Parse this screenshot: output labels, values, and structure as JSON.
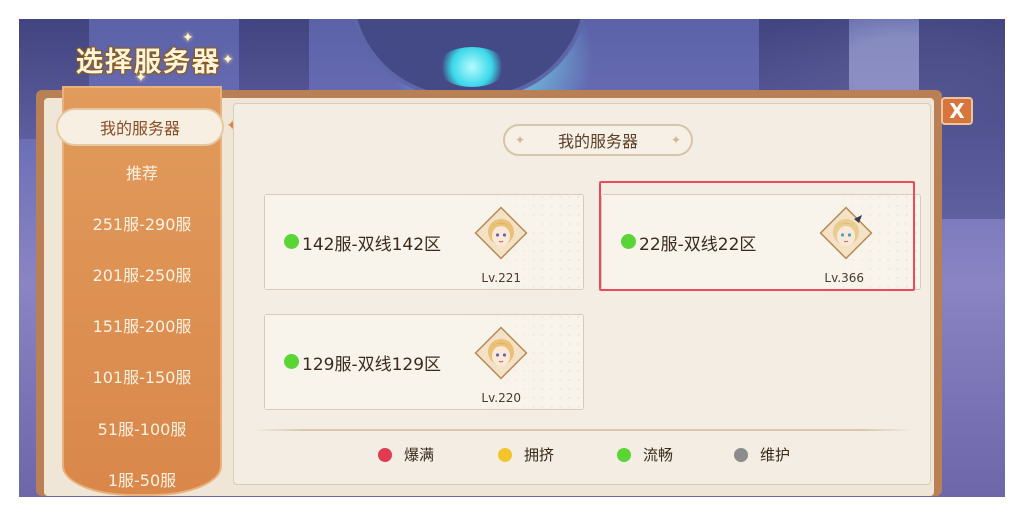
{
  "title": "选择服务器",
  "sidebar": {
    "items": [
      {
        "label": "我的服务器",
        "active": true
      },
      {
        "label": "推荐"
      },
      {
        "label": "251服-290服"
      },
      {
        "label": "201服-250服"
      },
      {
        "label": "151服-200服"
      },
      {
        "label": "101服-150服"
      },
      {
        "label": "51服-100服"
      },
      {
        "label": "1服-50服"
      }
    ]
  },
  "close_button": {
    "label": "X"
  },
  "section": {
    "title": "我的服务器"
  },
  "servers": [
    {
      "name": "142服-双线142区",
      "level": "Lv.221",
      "status": "流畅",
      "status_color": "#5bd435",
      "avatar": "character-portrait-a"
    },
    {
      "name": "22服-双线22区",
      "level": "Lv.366",
      "status": "流畅",
      "status_color": "#5bd435",
      "avatar": "character-portrait-b",
      "highlighted": true
    },
    {
      "name": "129服-双线129区",
      "level": "Lv.220",
      "status": "流畅",
      "status_color": "#5bd435",
      "avatar": "character-portrait-a"
    }
  ],
  "legend": [
    {
      "label": "爆满",
      "color": "#e23a4f"
    },
    {
      "label": "拥挤",
      "color": "#f3c52b"
    },
    {
      "label": "流畅",
      "color": "#5bd435"
    },
    {
      "label": "维护",
      "color": "#8c8c8c"
    }
  ]
}
